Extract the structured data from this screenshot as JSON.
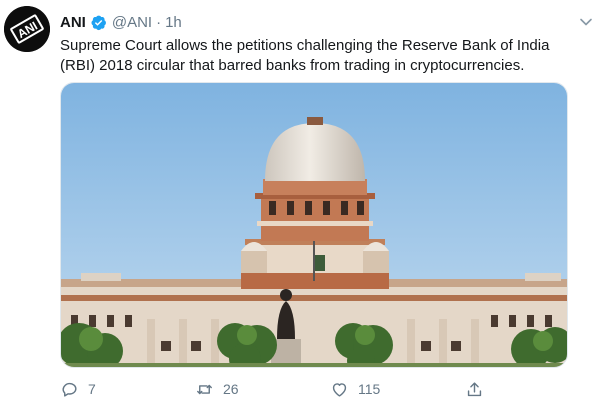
{
  "author": {
    "name": "ANI",
    "handle": "@ANI",
    "separator": "·",
    "time": "1h",
    "avatar_text": "ANI"
  },
  "tweet": {
    "text_line1": "Supreme Court allows the petitions challenging the Reserve Bank of India",
    "text_line2": "(RBI) 2018 circular that barred banks from trading in cryptocurrencies."
  },
  "actions": {
    "replies": "7",
    "retweets": "26",
    "likes": "115"
  },
  "icons": {
    "verified": "verified-badge-icon",
    "caret": "chevron-down-icon",
    "reply": "reply-icon",
    "retweet": "retweet-icon",
    "like": "heart-icon",
    "share": "share-icon"
  },
  "colors": {
    "verified_blue": "#1da1f2",
    "secondary_text": "#657786",
    "primary_text": "#14171a"
  }
}
